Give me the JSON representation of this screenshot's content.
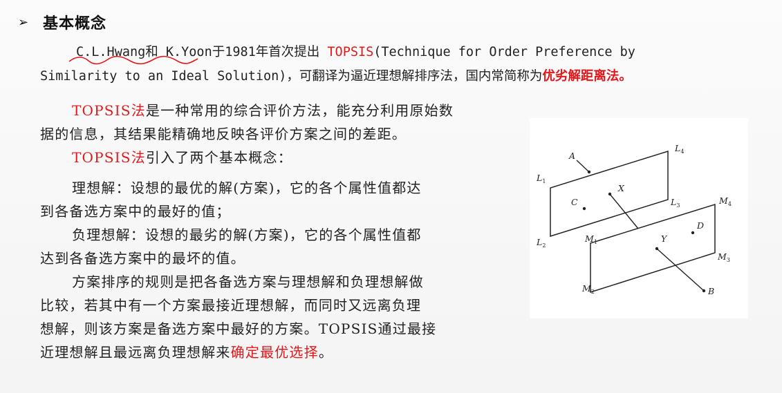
{
  "heading": {
    "arrow": "➢",
    "title": "基本概念"
  },
  "intro": {
    "authors": "C.L.Hwang和 K.Yoon",
    "year_text": "于1981年首次提出 ",
    "method": "TOPSIS",
    "full_name_a": "(Technique for Order Preference by",
    "full_name_b": "Similarity to an Ideal Solution)，可翻译为逼近理想解排序法，国内常简称为",
    "alias": "优劣解距离法。"
  },
  "paragraphs": {
    "p1_lead": "TOPSIS法",
    "p1_rest": "是一种常用的综合评价方法，能充分利用原始数",
    "p1_cont": "据的信息，其结果能精确地反映各评价方案之间的差距。",
    "p2_lead": "TOPSIS法",
    "p2_rest": "引入了两个基本概念：",
    "p3_term": "理想解：",
    "p3_rest": "设想的最优的解(方案)，它的各个属性值都达",
    "p3_cont": "到各备选方案中的最好的值；",
    "p4_term": "负理想解：",
    "p4_rest": "设想的最劣的解(方案)，它的各个属性值都",
    "p4_cont": "达到各备选方案中的最坏的值。",
    "p5_l1": "方案排序的规则是把各备选方案与理想解和负理想解做",
    "p5_l2": "比较，若其中有一个方案最接近理想解，而同时又远离负理",
    "p5_l3": "想解，则该方案是备选方案中最好的方案。TOPSIS通过最接",
    "p5_l4": "近理想解且最远离负理想解来",
    "p5_emph": "确定最优选择",
    "p5_end": "。"
  },
  "figure": {
    "labels": {
      "A": "A",
      "X": "X",
      "C": "C",
      "L": "L",
      "L1": "1",
      "L2": "2",
      "L3": "3",
      "L4": "4",
      "M": "M",
      "M1": "1",
      "M2": "2",
      "M3": "3",
      "M4": "4",
      "D": "D",
      "Y": "Y",
      "B": "B"
    }
  },
  "colors": {
    "accent_red": "#e0191c",
    "text": "#222222",
    "background": "#f6f6f6"
  }
}
